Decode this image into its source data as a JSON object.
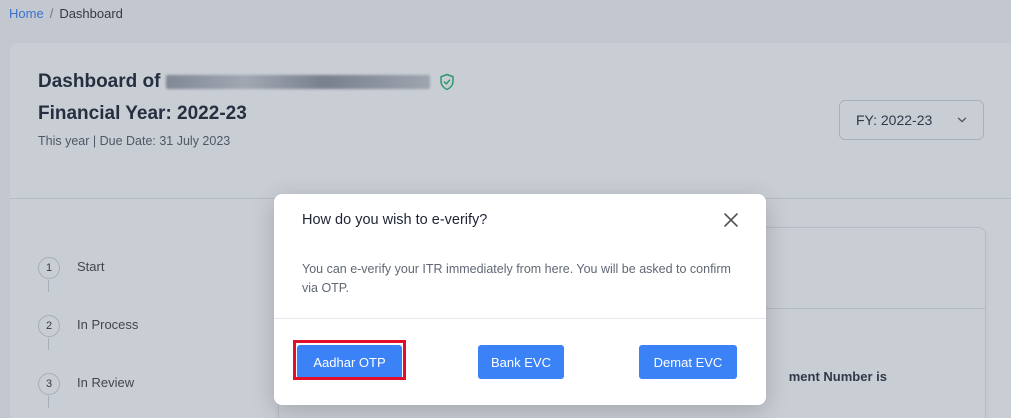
{
  "breadcrumb": {
    "home": "Home",
    "separator": "/",
    "current": "Dashboard"
  },
  "dashboard": {
    "title_prefix": "Dashboard of",
    "financial_year_title": "Financial Year: 2022-23",
    "due_date_line": "This year | Due Date: 31 July 2023",
    "fy_select": {
      "value": "FY: 2022-23"
    }
  },
  "steps": [
    {
      "number": "1",
      "label": "Start"
    },
    {
      "number": "2",
      "label": "In Process"
    },
    {
      "number": "3",
      "label": "In Review"
    }
  ],
  "right_panel": {
    "partial_text": "ment Number is"
  },
  "modal": {
    "title": "How do you wish to e-verify?",
    "body": "You can e-verify your ITR immediately from here. You will be asked to confirm via OTP.",
    "buttons": {
      "aadhar": "Aadhar OTP",
      "bank": "Bank EVC",
      "demat": "Demat EVC"
    }
  },
  "icons": {
    "verified": "shield-check-icon",
    "dropdown": "chevron-down-icon",
    "close": "close-icon"
  },
  "colors": {
    "primary": "#3b82f6",
    "link": "#3b82f6",
    "highlight": "#e0102a",
    "verified": "#2bb673"
  }
}
